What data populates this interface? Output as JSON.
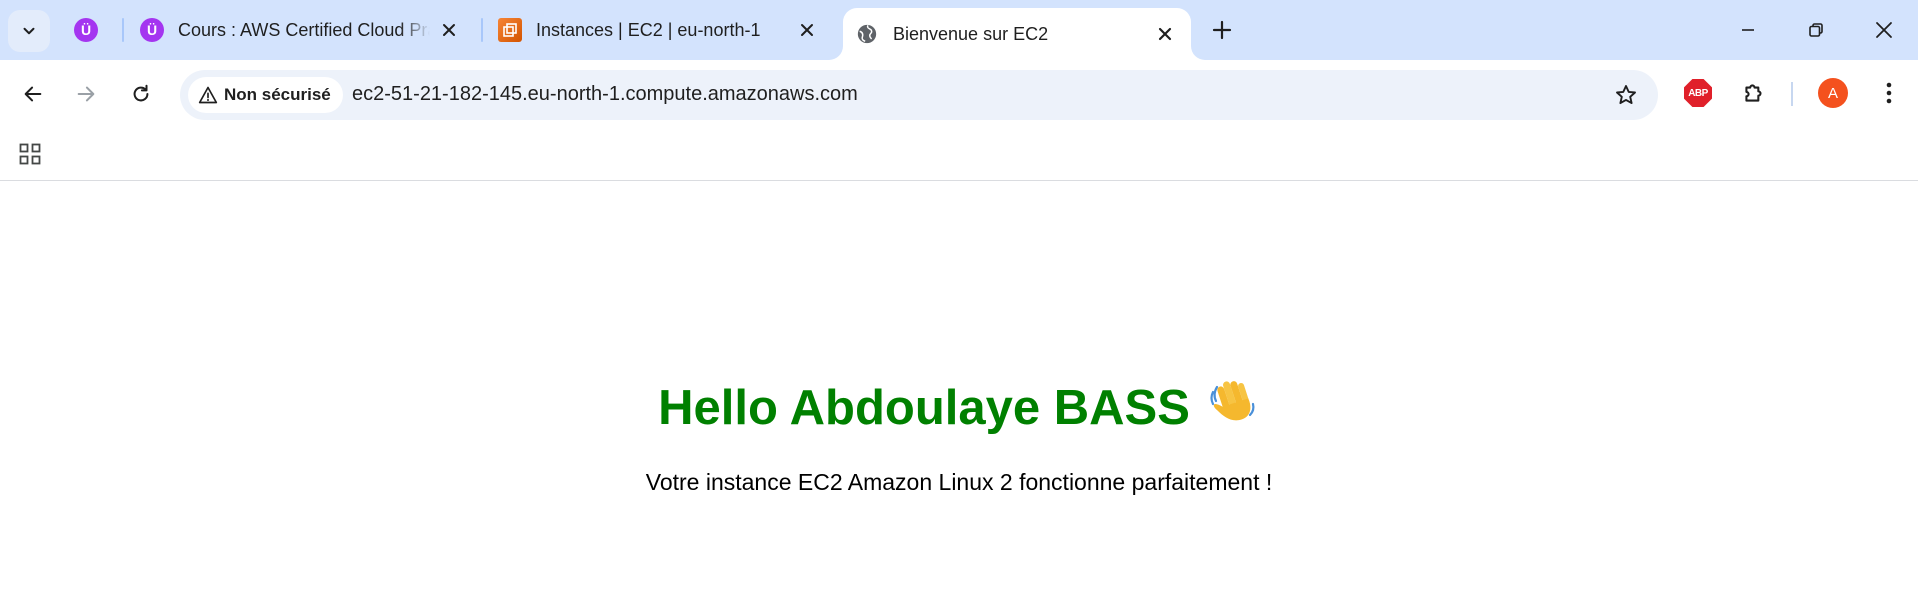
{
  "browser": {
    "tabs": [
      {
        "favicon": "udemy-icon",
        "title": "Cours : AWS Certified Cloud Practitioner",
        "active": false
      },
      {
        "favicon": "aws-ec2-icon",
        "title": "Instances | EC2 | eu-north-1",
        "active": false
      },
      {
        "favicon": "globe-icon",
        "title": "Bienvenue sur EC2",
        "active": true
      }
    ],
    "pinned_tab_icon": "udemy-icon",
    "tab_close_glyph": "✕",
    "new_tab_glyph": "+",
    "security_chip": "Non sécurisé",
    "url": "ec2-51-21-182-145.eu-north-1.compute.amazonaws.com",
    "extension_abp_label": "ABP",
    "profile_initial": "A",
    "colors": {
      "tabstrip": "#d3e3fd",
      "omnibox": "#edf2fa",
      "udemy": "#a435f0",
      "profile": "#f4511e",
      "abp": "#e0202a"
    }
  },
  "page": {
    "heading": "Hello Abdoulaye BASS",
    "heading_emoji": "waving-hand-icon",
    "message": "Votre instance EC2 Amazon Linux 2 fonctionne parfaitement !",
    "colors": {
      "heading": "#008000",
      "text": "#000000"
    }
  }
}
